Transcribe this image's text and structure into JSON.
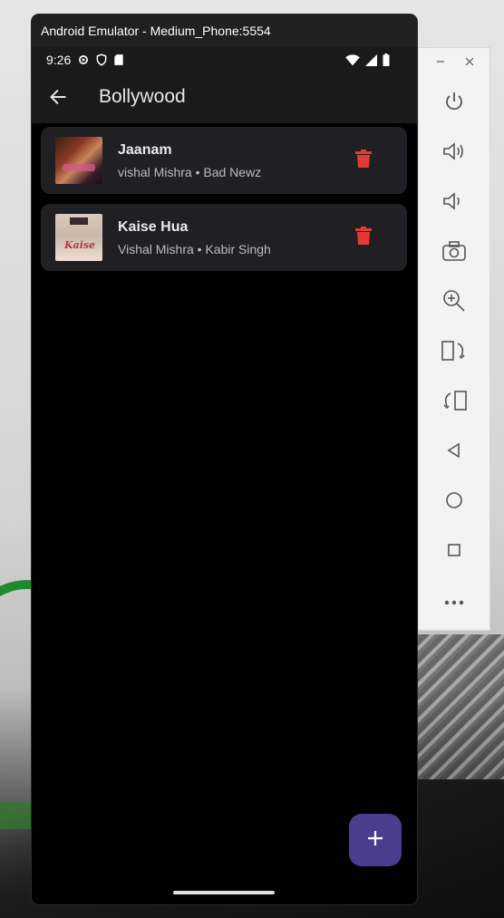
{
  "window": {
    "title": "Android Emulator - Medium_Phone:5554"
  },
  "status_bar": {
    "time": "9:26"
  },
  "app_bar": {
    "title": "Bollywood"
  },
  "songs": [
    {
      "title": "Jaanam",
      "subtitle": "vishal Mishra • Bad Newz"
    },
    {
      "title": "Kaise Hua",
      "subtitle": "Vishal Mishra • Kabir Singh"
    }
  ],
  "colors": {
    "delete": "#e53935",
    "fab": "#4a3d8f",
    "card": "#1f1f24"
  },
  "toolbar_icons": [
    "power-icon",
    "volume-up-icon",
    "volume-down-icon",
    "camera-icon",
    "zoom-icon",
    "rotate-left-icon",
    "rotate-right-icon",
    "back-icon",
    "home-icon",
    "overview-icon",
    "more-icon"
  ]
}
